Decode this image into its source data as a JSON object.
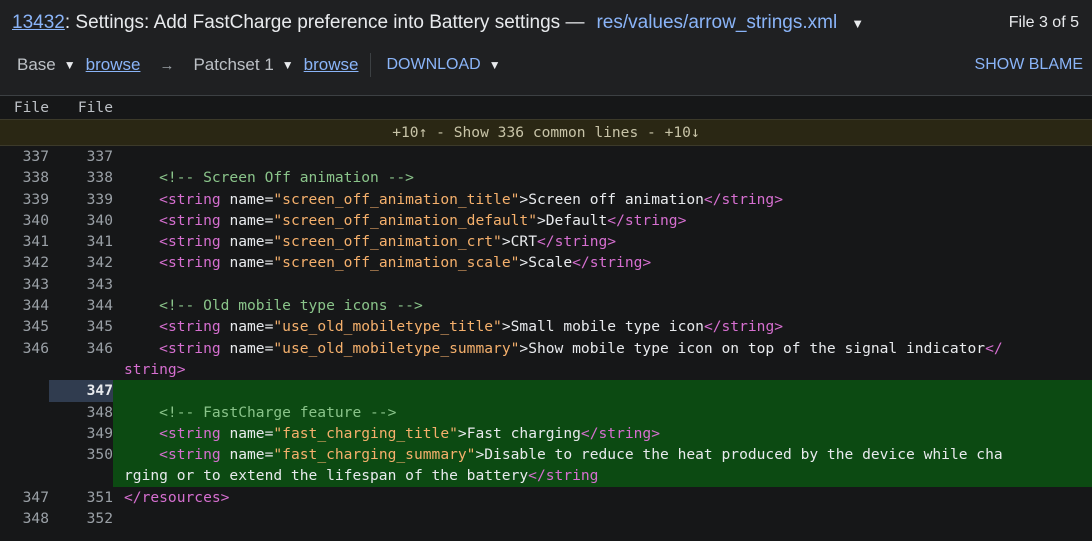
{
  "header": {
    "change_number": "13432",
    "subject": ": Settings: Add FastCharge preference into Battery settings —",
    "file_path": "res/values/arrow_strings.xml",
    "file_position": "File 3 of 5"
  },
  "toolbar": {
    "base_label": "Base",
    "base_browse": "browse",
    "arrow": "→",
    "patchset_label": "Patchset 1",
    "patchset_browse": "browse",
    "download_label": "DOWNLOAD",
    "show_blame": "SHOW BLAME"
  },
  "diff": {
    "left_header": "File",
    "right_header": "File",
    "context_bar": "+10↑  -  Show 336 common lines  -  +10↓",
    "rows": [
      {
        "l": "337",
        "r": "337",
        "type": "ctx",
        "parts": []
      },
      {
        "l": "338",
        "r": "338",
        "type": "ctx",
        "parts": [
          [
            "cm",
            "    <!-- Screen Off animation -->"
          ]
        ]
      },
      {
        "l": "339",
        "r": "339",
        "type": "ctx",
        "parts": [
          [
            "at",
            "    "
          ],
          [
            "tg",
            "<string "
          ],
          [
            "at",
            "name="
          ],
          [
            "st",
            "\"screen_off_animation_title\""
          ],
          [
            "at",
            ">Screen off animation"
          ],
          [
            "tg",
            "</string>"
          ]
        ]
      },
      {
        "l": "340",
        "r": "340",
        "type": "ctx",
        "parts": [
          [
            "at",
            "    "
          ],
          [
            "tg",
            "<string "
          ],
          [
            "at",
            "name="
          ],
          [
            "st",
            "\"screen_off_animation_default\""
          ],
          [
            "at",
            ">Default"
          ],
          [
            "tg",
            "</string>"
          ]
        ]
      },
      {
        "l": "341",
        "r": "341",
        "type": "ctx",
        "parts": [
          [
            "at",
            "    "
          ],
          [
            "tg",
            "<string "
          ],
          [
            "at",
            "name="
          ],
          [
            "st",
            "\"screen_off_animation_crt\""
          ],
          [
            "at",
            ">CRT"
          ],
          [
            "tg",
            "</string>"
          ]
        ]
      },
      {
        "l": "342",
        "r": "342",
        "type": "ctx",
        "parts": [
          [
            "at",
            "    "
          ],
          [
            "tg",
            "<string "
          ],
          [
            "at",
            "name="
          ],
          [
            "st",
            "\"screen_off_animation_scale\""
          ],
          [
            "at",
            ">Scale"
          ],
          [
            "tg",
            "</string>"
          ]
        ]
      },
      {
        "l": "343",
        "r": "343",
        "type": "ctx",
        "parts": []
      },
      {
        "l": "344",
        "r": "344",
        "type": "ctx",
        "parts": [
          [
            "cm",
            "    <!-- Old mobile type icons -->"
          ]
        ]
      },
      {
        "l": "345",
        "r": "345",
        "type": "ctx",
        "parts": [
          [
            "at",
            "    "
          ],
          [
            "tg",
            "<string "
          ],
          [
            "at",
            "name="
          ],
          [
            "st",
            "\"use_old_mobiletype_title\""
          ],
          [
            "at",
            ">Small mobile type icon"
          ],
          [
            "tg",
            "</string>"
          ]
        ]
      },
      {
        "l": "346",
        "r": "346",
        "type": "ctx",
        "parts": [
          [
            "at",
            "    "
          ],
          [
            "tg",
            "<string "
          ],
          [
            "at",
            "name="
          ],
          [
            "st",
            "\"use_old_mobiletype_summary\""
          ],
          [
            "at",
            ">Show mobile type icon on top of the signal indicator"
          ],
          [
            "tg",
            "</"
          ]
        ]
      },
      {
        "l": "",
        "r": "",
        "type": "ctx",
        "parts": [
          [
            "tg",
            "string>"
          ]
        ]
      },
      {
        "l": "",
        "r": "347",
        "type": "add sel",
        "parts": []
      },
      {
        "l": "",
        "r": "348",
        "type": "add",
        "parts": [
          [
            "cm",
            "    <!-- FastCharge feature -->"
          ]
        ]
      },
      {
        "l": "",
        "r": "349",
        "type": "add",
        "parts": [
          [
            "at",
            "    "
          ],
          [
            "tg",
            "<string "
          ],
          [
            "at",
            "name="
          ],
          [
            "st",
            "\"fast_charging_title\""
          ],
          [
            "at",
            ">Fast charging"
          ],
          [
            "tg",
            "</string>"
          ]
        ]
      },
      {
        "l": "",
        "r": "350",
        "type": "add",
        "parts": [
          [
            "at",
            "    "
          ],
          [
            "tg",
            "<string "
          ],
          [
            "at",
            "name="
          ],
          [
            "st",
            "\"fast_charging_summary\""
          ],
          [
            "at",
            ">Disable to reduce the heat produced by the device while cha"
          ]
        ]
      },
      {
        "l": "",
        "r": "",
        "type": "add",
        "parts": [
          [
            "at",
            "rging or to extend the lifespan of the battery"
          ],
          [
            "tg",
            "</string"
          ]
        ]
      },
      {
        "l": "347",
        "r": "351",
        "type": "ctx",
        "parts": [
          [
            "tg",
            "</resources>"
          ]
        ]
      },
      {
        "l": "348",
        "r": "352",
        "type": "ctx",
        "parts": []
      }
    ]
  },
  "colors": {
    "link": "#8ab4f8",
    "added_bg": "#0c4a12",
    "tag": "#d66fd0",
    "string_value": "#f5b06c",
    "comment": "#8ac48a"
  }
}
